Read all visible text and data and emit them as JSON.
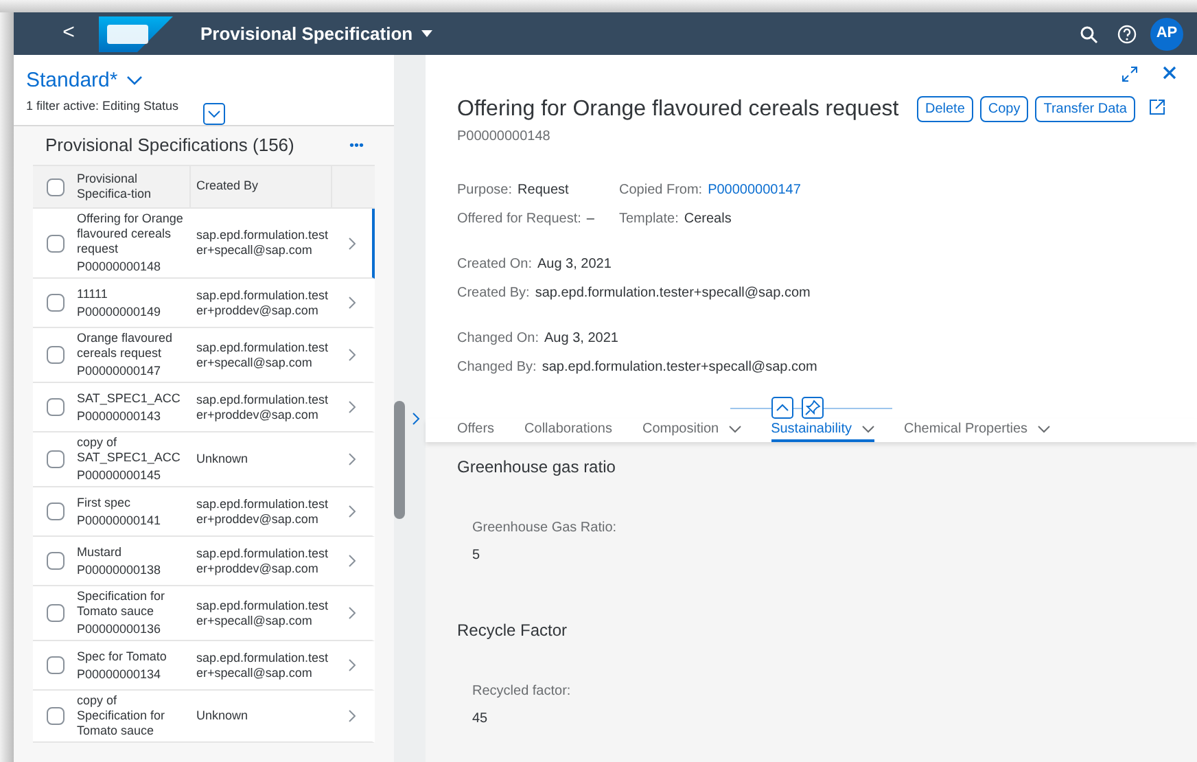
{
  "shell_bar": {
    "back": "<",
    "title": "Provisional Specification",
    "avatar": "AP"
  },
  "list_report": {
    "variant": "Standard*",
    "filter_info": "1 filter active: Editing Status",
    "table_title": "Provisional Specifications (156)",
    "more": "•••",
    "columns": [
      "Provisional Specifica-tion",
      "Created By"
    ],
    "all_checked": false,
    "rows": [
      {
        "name": "Offering for Orange flavoured cereals request",
        "id": "P00000000148",
        "created_by": "sap.epd.formulation.tester+specall@sap.com",
        "selected": true,
        "checked": false
      },
      {
        "name": "11111",
        "id": "P00000000149",
        "created_by": "sap.epd.formulation.tester+proddev@sap.com",
        "selected": false,
        "checked": false
      },
      {
        "name": "Orange flavoured cereals request",
        "id": "P00000000147",
        "created_by": "sap.epd.formulation.tester+specall@sap.com",
        "selected": false,
        "checked": false
      },
      {
        "name": "SAT_SPEC1_ACC",
        "id": "P00000000143",
        "created_by": "sap.epd.formulation.tester+proddev@sap.com",
        "selected": false,
        "checked": false
      },
      {
        "name": "copy of SAT_SPEC1_ACC",
        "id": "P00000000145",
        "created_by": "Unknown",
        "selected": false,
        "checked": false
      },
      {
        "name": "First spec",
        "id": "P00000000141",
        "created_by": "sap.epd.formulation.tester+proddev@sap.com",
        "selected": false,
        "checked": false
      },
      {
        "name": "Mustard",
        "id": "P00000000138",
        "created_by": "sap.epd.formulation.tester+proddev@sap.com",
        "selected": false,
        "checked": false
      },
      {
        "name": "Specification for Tomato sauce",
        "id": "P00000000136",
        "created_by": "sap.epd.formulation.tester+specall@sap.com",
        "selected": false,
        "checked": false
      },
      {
        "name": "Spec for Tomato",
        "id": "P00000000134",
        "created_by": "sap.epd.formulation.tester+specall@sap.com",
        "selected": false,
        "checked": false
      },
      {
        "name": "copy of Specification for Tomato sauce",
        "created_by": "Unknown",
        "selected": false,
        "checked": false
      }
    ]
  },
  "object_page": {
    "title": "Offering for Orange flavoured cereals request",
    "subtitle": "P00000000148",
    "actions": [
      "Delete",
      "Copy",
      "Transfer Data"
    ],
    "header_fields": [
      {
        "label": "Purpose:",
        "value": "Request",
        "kind": "text"
      },
      {
        "label": "Copied From:",
        "value": "P00000000147",
        "kind": "link"
      },
      {
        "label": "Offered for Request:",
        "value": "–",
        "kind": "text"
      },
      {
        "label": "Template:",
        "value": "Cereals",
        "kind": "text"
      }
    ],
    "admin_groups": [
      [
        {
          "label": "Created On:",
          "value": "Aug 3, 2021"
        },
        {
          "label": "Created By:",
          "value": "sap.epd.formulation.tester+specall@sap.com"
        }
      ],
      [
        {
          "label": "Changed On:",
          "value": "Aug 3, 2021"
        },
        {
          "label": "Changed By:",
          "value": "sap.epd.formulation.tester+specall@sap.com"
        }
      ]
    ],
    "tabs": [
      {
        "label": "Offers",
        "has_menu": false,
        "selected": false
      },
      {
        "label": "Collaborations",
        "has_menu": false,
        "selected": false
      },
      {
        "label": "Composition",
        "has_menu": true,
        "selected": false
      },
      {
        "label": "Sustainability",
        "has_menu": true,
        "selected": true
      },
      {
        "label": "Chemical Properties",
        "has_menu": true,
        "selected": false
      }
    ],
    "sections": [
      {
        "title": "Greenhouse gas ratio",
        "field": {
          "label": "Greenhouse Gas Ratio:",
          "value": "5"
        }
      },
      {
        "title": "Recycle Factor",
        "field": {
          "label": "Recycled factor:",
          "value": "45"
        }
      }
    ]
  }
}
